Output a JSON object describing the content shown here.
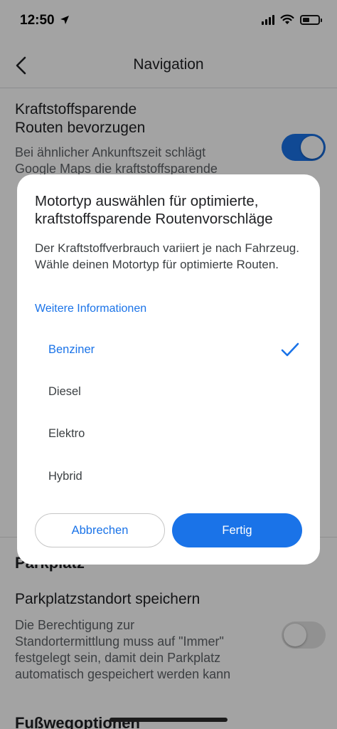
{
  "status_bar": {
    "time": "12:50"
  },
  "header": {
    "title": "Navigation",
    "back_icon": "chevron-left-icon"
  },
  "settings": {
    "fuel_efficient": {
      "title_line1": "Kraftstoffsparende",
      "title_line2": "Routen bevorzugen",
      "desc_line1": "Bei ähnlicher Ankunftszeit schlägt",
      "desc_line2": "Google Maps die kraftstoffsparende",
      "toggle": "on"
    },
    "parking_section_title": "Parkplatz",
    "save_parking": {
      "title": "Parkplatzstandort speichern",
      "desc_line1": "Die Berechtigung zur",
      "desc_line2": "Standortermittlung muss auf \"Immer\"",
      "desc_line3": "festgelegt sein, damit dein Parkplatz",
      "desc_line4": "automatisch gespeichert werden kann",
      "toggle": "off"
    },
    "walking_section_title": "Fußwegoptionen"
  },
  "dialog": {
    "title": "Motortyp auswählen für optimierte, kraftstoffsparende Routenvorschläge",
    "body": "Der Kraftstoffverbrauch variiert je nach Fahrzeug. Wähle deinen Motortyp für optimierte Routen.",
    "link": "Weitere Informationen",
    "options": [
      {
        "label": "Benziner",
        "selected": true
      },
      {
        "label": "Diesel",
        "selected": false
      },
      {
        "label": "Elektro",
        "selected": false
      },
      {
        "label": "Hybrid",
        "selected": false
      }
    ],
    "cancel_label": "Abbrechen",
    "done_label": "Fertig"
  },
  "colors": {
    "accent": "#1a73e8",
    "scrim": "rgba(0,0,0,0.36)"
  }
}
